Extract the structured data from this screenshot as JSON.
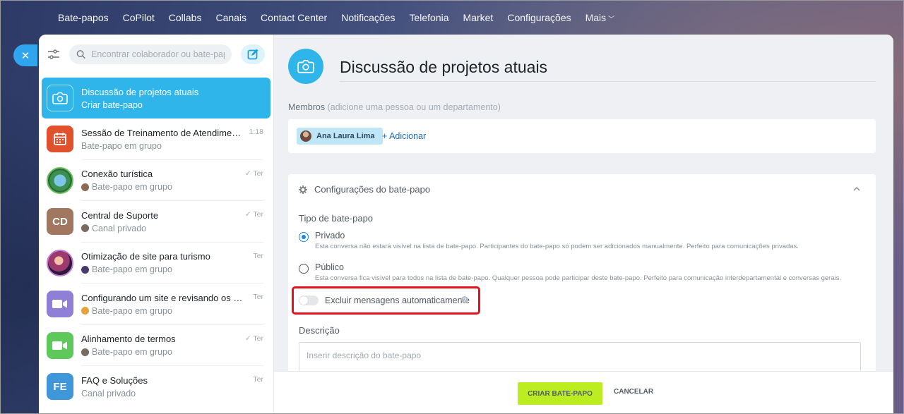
{
  "nav": {
    "items": [
      "Bate-papos",
      "CoPilot",
      "Collabs",
      "Canais",
      "Contact Center",
      "Notificações",
      "Telefonia",
      "Market",
      "Configurações",
      "Mais"
    ]
  },
  "sidebar": {
    "search_placeholder": "Encontrar colaborador ou bate-papo",
    "active": {
      "title": "Discussão de projetos atuais",
      "subtitle": "Criar bate-papo"
    },
    "chats": [
      {
        "title": "Sessão de Treinamento de Atendiment...",
        "subtitle": "Bate-papo em grupo",
        "time": "1:18",
        "avatar": "calendar-icon",
        "color": "#e2512d"
      },
      {
        "title": "Conexão turística",
        "subtitle": "Bate-papo em grupo",
        "time": "✓ Ter",
        "avatar": "photo",
        "color": "#3a8a4a"
      },
      {
        "title": "Central de Suporte",
        "subtitle": "Canal privado",
        "time": "✓ Ter",
        "avatar": "CD",
        "color": "#a2775f"
      },
      {
        "title": "Otimização de site para turismo",
        "subtitle": "Bate-papo em grupo",
        "time": "Ter",
        "avatar": "photo",
        "color": "#6a3b5e"
      },
      {
        "title": "Configurando um site e revisando os te...",
        "subtitle": "Bate-papo em grupo",
        "time": "Ter",
        "avatar": "video-icon",
        "color": "#8f7fd6"
      },
      {
        "title": "Alinhamento de termos",
        "subtitle": "Bate-papo em grupo",
        "time": "✓ Ter",
        "avatar": "video-icon",
        "color": "#5ec85a"
      },
      {
        "title": "FAQ e Soluções",
        "subtitle": "Canal privado",
        "time": "Ter",
        "avatar": "FE",
        "color": "#3d97d9"
      }
    ]
  },
  "main": {
    "title": "Discussão de projetos atuais",
    "members_label": "Membros",
    "members_hint": "(adicione uma pessoa ou um departamento)",
    "member_name": "Ana Laura Lima",
    "add_label": "+ Adicionar",
    "settings_title": "Configurações do bate-papo",
    "type_label": "Tipo de bate-papo",
    "private_label": "Privado",
    "private_desc": "Esta conversa não estará visível na lista de bate-papo. Participantes do bate-papo só podem ser adicionados manualmente. Perfeito para comunicações privadas.",
    "public_label": "Público",
    "public_desc": "Esta conversa fica visível para todos na lista de bate-papo. Qualquer pessoa pode participar deste bate-papo. Perfeito para comunicação interdepartamental e conversas gerais.",
    "auto_delete_label": "Excluir mensagens automaticamente",
    "description_label": "Descrição",
    "description_placeholder": "Inserir descrição do bate-papo",
    "create_button": "CRIAR BATE-PAPO",
    "cancel_button": "CANCELAR"
  }
}
